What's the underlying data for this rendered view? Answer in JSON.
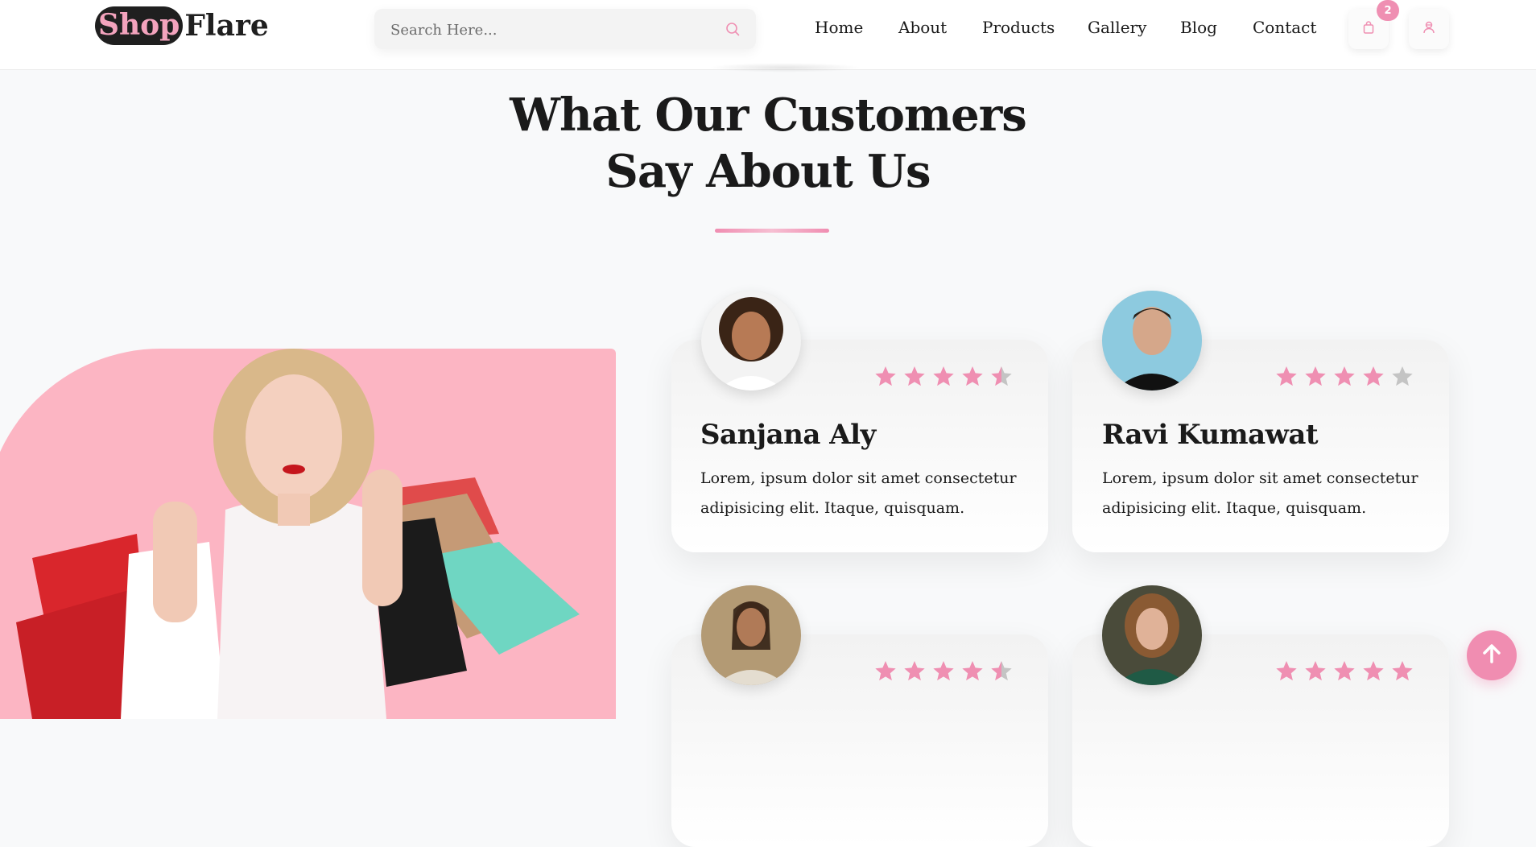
{
  "header": {
    "logo_part1": "Shop",
    "logo_part2": "Flare",
    "search_placeholder": "Search Here...",
    "nav": [
      "Home",
      "About",
      "Products",
      "Gallery",
      "Blog",
      "Contact"
    ],
    "cart_count": "2",
    "icons": {
      "search": "search-icon",
      "cart": "shopping-bag-icon",
      "user": "user-icon"
    }
  },
  "section": {
    "title_line1": "What Our Customers",
    "title_line2": "Say About Us"
  },
  "testimonials": [
    {
      "name": "Sanjana Aly",
      "rating": 4.5,
      "text": "Lorem, ipsum dolor sit amet consectetur adipisicing elit. Itaque, quisquam."
    },
    {
      "name": "Ravi Kumawat",
      "rating": 4,
      "text": "Lorem, ipsum dolor sit amet consectetur adipisicing elit. Itaque, quisquam."
    },
    {
      "name": "",
      "rating": 4.5,
      "text": ""
    },
    {
      "name": "",
      "rating": 5,
      "text": ""
    }
  ],
  "colors": {
    "accent": "#ef8fb2",
    "hero_bg": "#fcb5c3",
    "star_empty": "#c4c4c4",
    "page_bg": "#f8f9fa"
  },
  "back_to_top_icon": "arrow-up-icon"
}
